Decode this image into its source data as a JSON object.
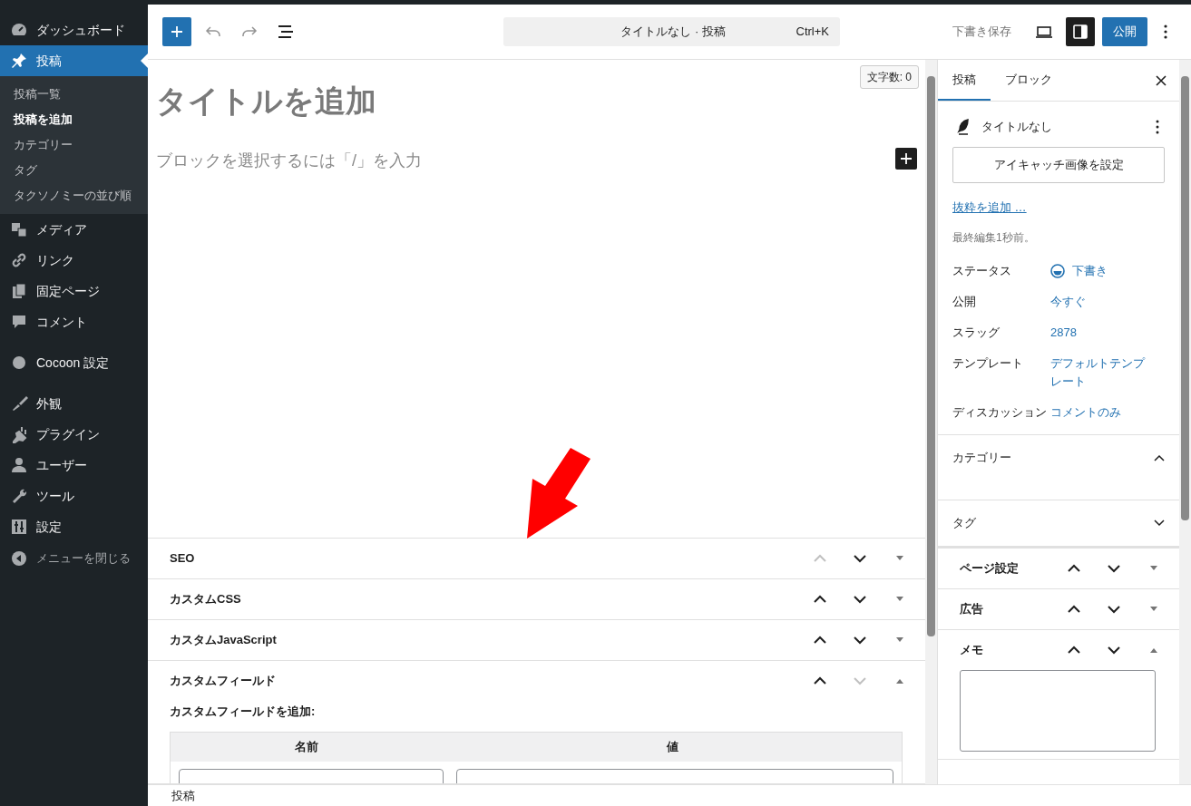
{
  "admin_menu": {
    "groups": [
      [
        {
          "label": "ダッシュボード",
          "selected": false
        },
        {
          "label": "投稿",
          "selected": true,
          "children": [
            {
              "label": "投稿一覧",
              "selected": false
            },
            {
              "label": "投稿を追加",
              "selected": true
            },
            {
              "label": "カテゴリー",
              "selected": false
            },
            {
              "label": "タグ",
              "selected": false
            },
            {
              "label": "タクソノミーの並び順",
              "selected": false
            }
          ]
        },
        {
          "label": "メディア",
          "selected": false
        },
        {
          "label": "リンク",
          "selected": false
        },
        {
          "label": "固定ページ",
          "selected": false
        },
        {
          "label": "コメント",
          "selected": false
        }
      ],
      [
        {
          "label": "Cocoon 設定",
          "selected": false
        }
      ],
      [
        {
          "label": "外観",
          "selected": false
        },
        {
          "label": "プラグイン",
          "selected": false
        },
        {
          "label": "ユーザー",
          "selected": false
        },
        {
          "label": "ツール",
          "selected": false
        },
        {
          "label": "設定",
          "selected": false
        }
      ]
    ],
    "collapse": "メニューを閉じる"
  },
  "toolbar": {
    "command": "タイトルなし · 投稿",
    "shortcut": "Ctrl+K",
    "save_draft": "下書き保存",
    "settings_pressed": true,
    "publish": "公開"
  },
  "editor": {
    "word_count": "文字数: 0",
    "title_placeholder": "タイトルを追加",
    "block_placeholder": "ブロックを選択するには「/」を入力"
  },
  "metaboxes": [
    {
      "title": "SEO",
      "up_disabled": true,
      "down_disabled": false,
      "expanded": false
    },
    {
      "title": "カスタムCSS",
      "up_disabled": false,
      "down_disabled": false,
      "expanded": false
    },
    {
      "title": "カスタムJavaScript",
      "up_disabled": false,
      "down_disabled": false,
      "expanded": false
    },
    {
      "title": "カスタムフィールド",
      "up_disabled": false,
      "down_disabled": true,
      "expanded": true
    }
  ],
  "custom_fields": {
    "add_label": "カスタムフィールドを追加:",
    "columns": [
      "名前",
      "値"
    ]
  },
  "settings_sidebar": {
    "tabs": [
      {
        "label": "投稿",
        "selected": true
      },
      {
        "label": "ブロック",
        "selected": false
      }
    ],
    "post_title": "タイトルなし",
    "featured_image": "アイキャッチ画像を設定",
    "excerpt": "抜粋を追加 …",
    "last_edited": "最終編集1秒前。",
    "rows": [
      {
        "label": "ステータス",
        "value": "下書き",
        "kind": "status"
      },
      {
        "label": "公開",
        "value": "今すぐ"
      },
      {
        "label": "スラッグ",
        "value": "2878"
      },
      {
        "label": "テンプレート",
        "value": "デフォルトテンプレート"
      },
      {
        "label": "ディスカッション",
        "value": "コメントのみ"
      }
    ],
    "panels": [
      {
        "title": "カテゴリー",
        "expanded": true
      },
      {
        "title": "タグ",
        "expanded": false
      }
    ],
    "metaboxes": [
      {
        "title": "ページ設定",
        "expanded": false
      },
      {
        "title": "広告",
        "expanded": false
      },
      {
        "title": "メモ",
        "expanded": true
      }
    ]
  },
  "status_bar": "投稿"
}
